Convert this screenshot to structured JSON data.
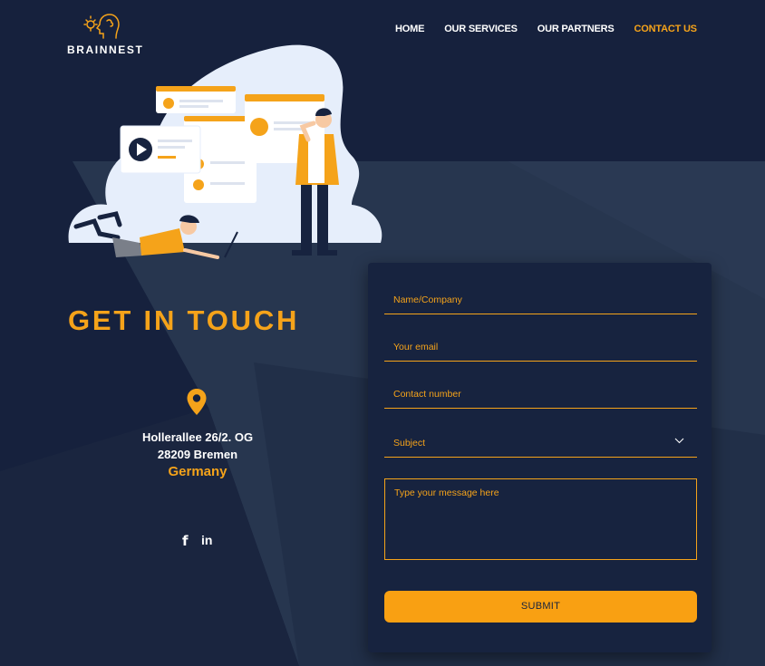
{
  "brand": {
    "name": "BRAINNEST",
    "accent_color": "#f5a31a",
    "background_color": "#16213d"
  },
  "nav": {
    "items": [
      {
        "label": "HOME"
      },
      {
        "label": "OUR SERVICES"
      },
      {
        "label": "OUR PARTNERS"
      },
      {
        "label": "CONTACT US"
      }
    ],
    "active_item": "CONTACT US"
  },
  "contact": {
    "heading": "GET IN TOUCH",
    "address_line1": "Hollerallee 26/2. OG",
    "address_line2": "28209 Bremen",
    "country": "Germany",
    "location_icon": "map-pin-icon",
    "social": {
      "facebook_label": "f",
      "linkedin_label": "in"
    }
  },
  "form": {
    "name_placeholder": "Name/Company",
    "email_placeholder": "Your email",
    "phone_placeholder": "Contact number",
    "subject_placeholder": "Subject",
    "message_placeholder": "Type your message here",
    "submit_label": "SUBMIT"
  }
}
